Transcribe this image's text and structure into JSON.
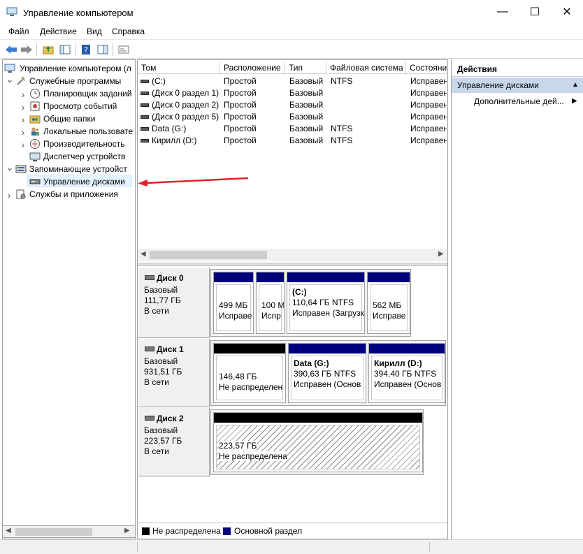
{
  "window": {
    "title": "Управление компьютером",
    "minimize_glyph": "—",
    "maximize_glyph": "☐",
    "close_glyph": "✕"
  },
  "menu": [
    "Файл",
    "Действие",
    "Вид",
    "Справка"
  ],
  "toolbar_icons": [
    "back-arrow-icon",
    "forward-arrow-icon",
    "up-folder-icon",
    "show-hide-tree-icon",
    "help-icon",
    "properties-icon",
    "console-icon"
  ],
  "tree": {
    "root": "Управление компьютером (л",
    "items": [
      {
        "label": "Служебные программы",
        "level": 1,
        "expanded": true,
        "icon": "tools-icon"
      },
      {
        "label": "Планировщик заданий",
        "level": 2,
        "expanded": false,
        "icon": "clock-icon"
      },
      {
        "label": "Просмотр событий",
        "level": 2,
        "expanded": false,
        "icon": "event-viewer-icon"
      },
      {
        "label": "Общие папки",
        "level": 2,
        "expanded": false,
        "icon": "shared-folder-icon"
      },
      {
        "label": "Локальные пользовате",
        "level": 2,
        "expanded": false,
        "icon": "users-icon"
      },
      {
        "label": "Производительность",
        "level": 2,
        "expanded": false,
        "icon": "performance-icon"
      },
      {
        "label": "Диспетчер устройств",
        "level": 2,
        "expanded": null,
        "icon": "device-manager-icon"
      },
      {
        "label": "Запоминающие устройст",
        "level": 1,
        "expanded": true,
        "icon": "storage-icon"
      },
      {
        "label": "Управление дисками",
        "level": 2,
        "expanded": null,
        "icon": "disk-management-icon",
        "selected": true
      },
      {
        "label": "Службы и приложения",
        "level": 1,
        "expanded": false,
        "icon": "services-icon"
      }
    ]
  },
  "volumes": {
    "columns": [
      "Том",
      "Расположение",
      "Тип",
      "Файловая система",
      "Состояни"
    ],
    "rows": [
      [
        "(C:)",
        "Простой",
        "Базовый",
        "NTFS",
        "Исправен"
      ],
      [
        "(Диск 0 раздел 1)",
        "Простой",
        "Базовый",
        "",
        "Исправен"
      ],
      [
        "(Диск 0 раздел 2)",
        "Простой",
        "Базовый",
        "",
        "Исправен"
      ],
      [
        "(Диск 0 раздел 5)",
        "Простой",
        "Базовый",
        "",
        "Исправен"
      ],
      [
        "Data (G:)",
        "Простой",
        "Базовый",
        "NTFS",
        "Исправен"
      ],
      [
        "Кирилл (D:)",
        "Простой",
        "Базовый",
        "NTFS",
        "Исправен"
      ]
    ]
  },
  "disks": [
    {
      "name": "Диск 0",
      "type": "Базовый",
      "size": "111,77 ГБ",
      "status": "В сети",
      "partitions": [
        {
          "title": "",
          "line1": "499 МБ",
          "line2": "Исправе",
          "kind": "primary"
        },
        {
          "title": "",
          "line1": "100 М",
          "line2": "Испр",
          "kind": "primary"
        },
        {
          "title": "(C:)",
          "line1": "110,64 ГБ NTFS",
          "line2": "Исправен (Загрузк",
          "kind": "primary"
        },
        {
          "title": "",
          "line1": "562 МБ",
          "line2": "Исправе",
          "kind": "primary"
        }
      ]
    },
    {
      "name": "Диск 1",
      "type": "Базовый",
      "size": "931,51 ГБ",
      "status": "В сети",
      "partitions": [
        {
          "title": "",
          "line1": "146,48 ГБ",
          "line2": "Не распределен",
          "kind": "unallocated"
        },
        {
          "title": "Data  (G:)",
          "line1": "390,63 ГБ NTFS",
          "line2": "Исправен (Основ",
          "kind": "primary"
        },
        {
          "title": "Кирилл  (D:)",
          "line1": "394,40 ГБ NTFS",
          "line2": "Исправен (Основ",
          "kind": "primary"
        }
      ]
    },
    {
      "name": "Диск 2",
      "type": "Базовый",
      "size": "223,57 ГБ",
      "status": "В сети",
      "partitions": [
        {
          "title": "",
          "line1": "223,57 ГБ",
          "line2": "Не распределена",
          "kind": "unallocated"
        }
      ]
    }
  ],
  "legend": [
    {
      "label": "Не распределена",
      "color": "#000000"
    },
    {
      "label": "Основной раздел",
      "color": "#00007f"
    }
  ],
  "actions": {
    "title": "Действия",
    "section": "Управление дисками",
    "more": "Дополнительные дей..."
  },
  "colors": {
    "primary": "#00007f",
    "unallocated": "#000000",
    "selection": "#e5f3ff",
    "arrow": "#e0202a"
  }
}
